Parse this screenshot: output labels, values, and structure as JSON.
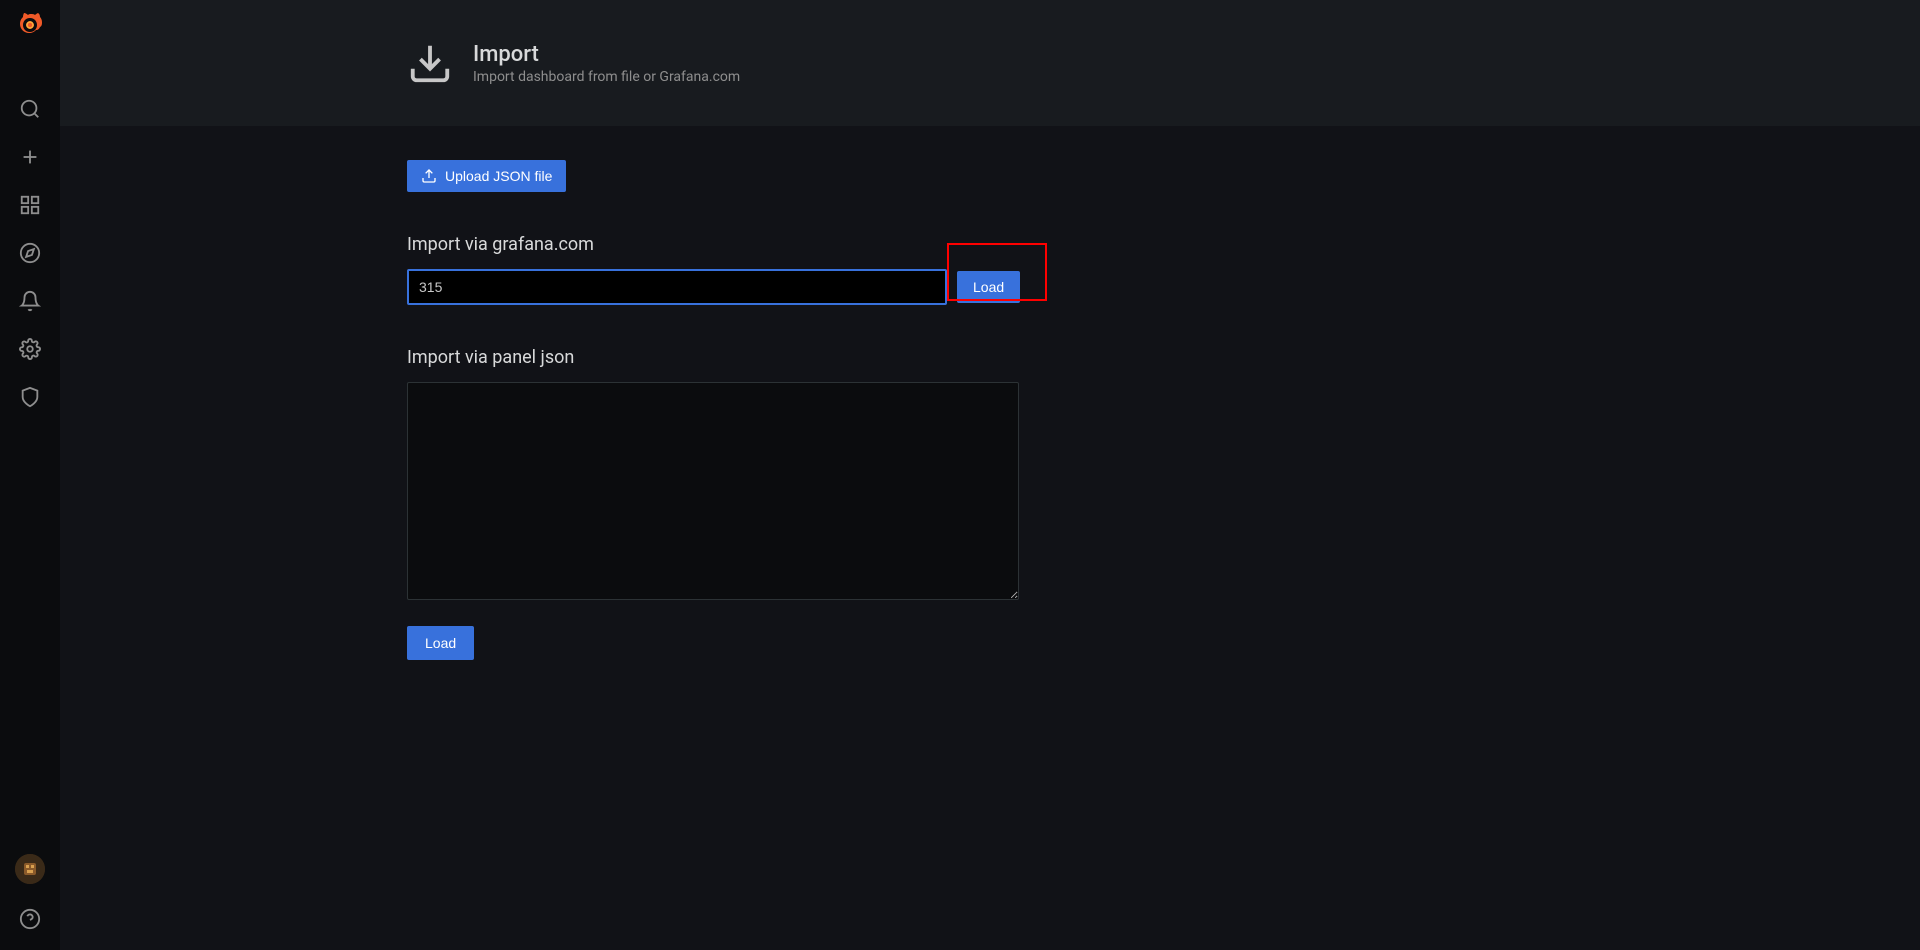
{
  "header": {
    "title": "Import",
    "subtitle": "Import dashboard from file or Grafana.com"
  },
  "buttons": {
    "upload": "Upload JSON file",
    "load1": "Load",
    "load2": "Load"
  },
  "sections": {
    "grafana_label": "Import via grafana.com",
    "json_label": "Import via panel json"
  },
  "inputs": {
    "grafana_value": "315",
    "json_value": ""
  }
}
